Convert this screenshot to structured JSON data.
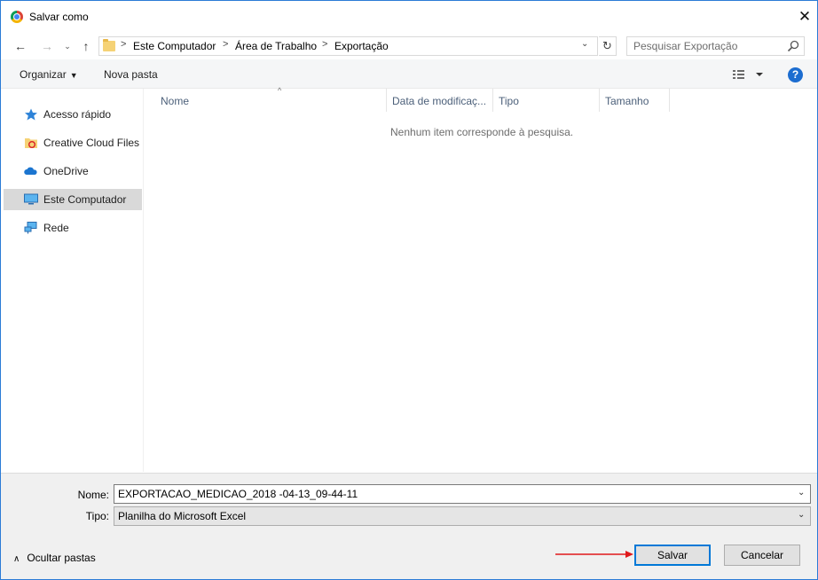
{
  "window": {
    "title": "Salvar como",
    "close_glyph": "✕",
    "border_color": "#2b7bd6"
  },
  "nav": {
    "back_glyph": "←",
    "forward_glyph": "→",
    "recent_glyph": "⌄",
    "up_glyph": "↑",
    "breadcrumbs": [
      "Este Computador",
      "Área de Trabalho",
      "Exportação"
    ],
    "breadcrumb_separator": ">",
    "address_dropdown_glyph": "⌄",
    "refresh_glyph": "↻",
    "search_placeholder": "Pesquisar Exportação"
  },
  "toolbar": {
    "organize_label": "Organizar",
    "organize_caret": "▼",
    "new_folder_label": "Nova pasta",
    "view_icon": "view-details-icon",
    "help_glyph": "?"
  },
  "sidebar": {
    "items": [
      {
        "label": "Acesso rápido",
        "icon": "star-icon",
        "selected": false
      },
      {
        "label": "Creative Cloud Files",
        "icon": "creative-cloud-folder-icon",
        "selected": false
      },
      {
        "label": "OneDrive",
        "icon": "cloud-icon",
        "selected": false
      },
      {
        "label": "Este Computador",
        "icon": "monitor-icon",
        "selected": true
      },
      {
        "label": "Rede",
        "icon": "network-icon",
        "selected": false
      }
    ]
  },
  "file_list": {
    "columns": [
      "Nome",
      "Data de modificaç...",
      "Tipo",
      "Tamanho"
    ],
    "sort_glyph": "^",
    "empty_message": "Nenhum item corresponde à pesquisa."
  },
  "form": {
    "name_label": "Nome:",
    "name_value": "EXPORTACAO_MEDICAO_2018 -04-13_09-44-11",
    "type_label": "Tipo:",
    "type_value": "Planilha do Microsoft Excel",
    "dropdown_glyph": "⌄"
  },
  "footer": {
    "hide_folders_label": "Ocultar pastas",
    "hide_folders_glyph": "∧",
    "save_label": "Salvar",
    "cancel_label": "Cancelar",
    "accent_color": "#0078d7",
    "annotation_arrow_color": "#e0191b"
  }
}
